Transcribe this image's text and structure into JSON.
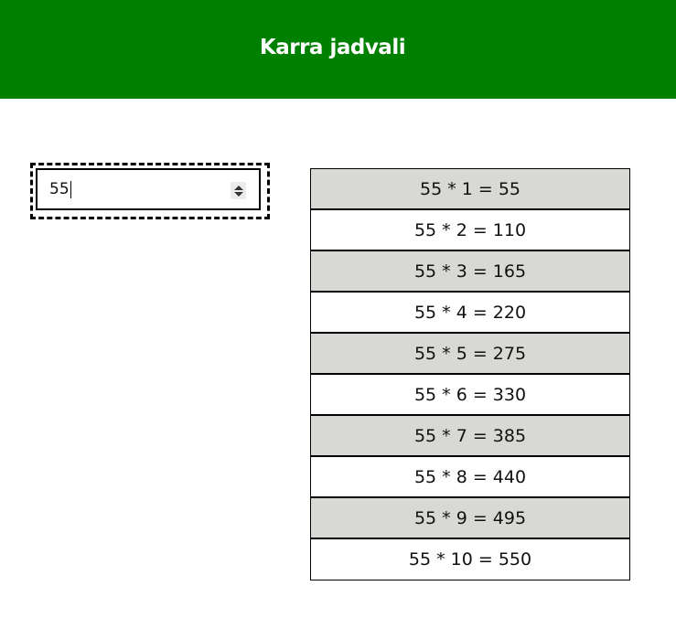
{
  "header": {
    "title": "Karra jadvali",
    "background_color": "#008000"
  },
  "input": {
    "value": "55",
    "type": "number"
  },
  "table": {
    "rows": [
      "55 * 1 = 55",
      "55 * 2 = 110",
      "55 * 3 = 165",
      "55 * 4 = 220",
      "55 * 5 = 275",
      "55 * 6 = 330",
      "55 * 7 = 385",
      "55 * 8 = 440",
      "55 * 9 = 495",
      "55 * 10 = 550"
    ],
    "odd_row_color": "#d8d8d5",
    "even_row_color": "#ffffff"
  },
  "icons": {
    "spinner": "up-down-arrows-icon"
  }
}
